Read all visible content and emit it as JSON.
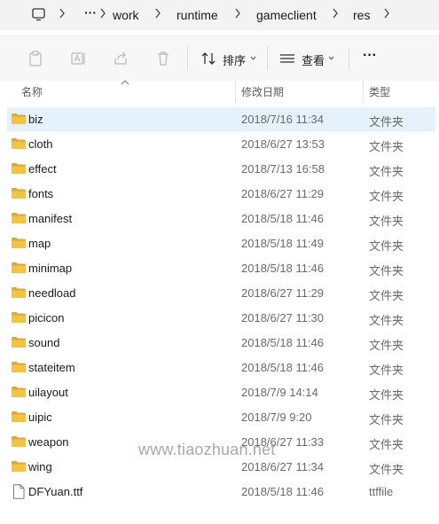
{
  "address_bar": {
    "overflow": "···",
    "crumbs": [
      "work",
      "runtime",
      "gameclient",
      "res"
    ]
  },
  "toolbar": {
    "sort_label": "排序",
    "view_label": "查看",
    "more_label": "···"
  },
  "columns": {
    "name": "名称",
    "modified": "修改日期",
    "type": "类型"
  },
  "files": [
    {
      "name": "biz",
      "date": "2018/7/16 11:34",
      "type": "文件夹",
      "icon": "folder-icon",
      "selected": true
    },
    {
      "name": "cloth",
      "date": "2018/6/27 13:53",
      "type": "文件夹",
      "icon": "folder-icon"
    },
    {
      "name": "effect",
      "date": "2018/7/13 16:58",
      "type": "文件夹",
      "icon": "folder-icon"
    },
    {
      "name": "fonts",
      "date": "2018/6/27 11:29",
      "type": "文件夹",
      "icon": "folder-icon"
    },
    {
      "name": "manifest",
      "date": "2018/5/18 11:46",
      "type": "文件夹",
      "icon": "folder-icon"
    },
    {
      "name": "map",
      "date": "2018/5/18 11:49",
      "type": "文件夹",
      "icon": "folder-icon"
    },
    {
      "name": "minimap",
      "date": "2018/5/18 11:46",
      "type": "文件夹",
      "icon": "folder-icon"
    },
    {
      "name": "needload",
      "date": "2018/6/27 11:29",
      "type": "文件夹",
      "icon": "folder-icon"
    },
    {
      "name": "picicon",
      "date": "2018/6/27 11:30",
      "type": "文件夹",
      "icon": "folder-icon"
    },
    {
      "name": "sound",
      "date": "2018/5/18 11:46",
      "type": "文件夹",
      "icon": "folder-icon"
    },
    {
      "name": "stateitem",
      "date": "2018/5/18 11:46",
      "type": "文件夹",
      "icon": "folder-icon"
    },
    {
      "name": "uilayout",
      "date": "2018/7/9 14:14",
      "type": "文件夹",
      "icon": "folder-icon"
    },
    {
      "name": "uipic",
      "date": "2018/7/9 9:20",
      "type": "文件夹",
      "icon": "folder-icon"
    },
    {
      "name": "weapon",
      "date": "2018/6/27 11:33",
      "type": "文件夹",
      "icon": "folder-icon"
    },
    {
      "name": "wing",
      "date": "2018/6/27 11:34",
      "type": "文件夹",
      "icon": "folder-icon"
    },
    {
      "name": "DFYuan.ttf",
      "date": "2018/5/18 11:46",
      "type": "ttffile",
      "icon": "file-icon"
    }
  ],
  "watermark": "www.tiaozhuan.net",
  "colors": {
    "selected_row": "#e5f1fb",
    "folder": "#f5c242",
    "folder_dark": "#e0a82e"
  }
}
